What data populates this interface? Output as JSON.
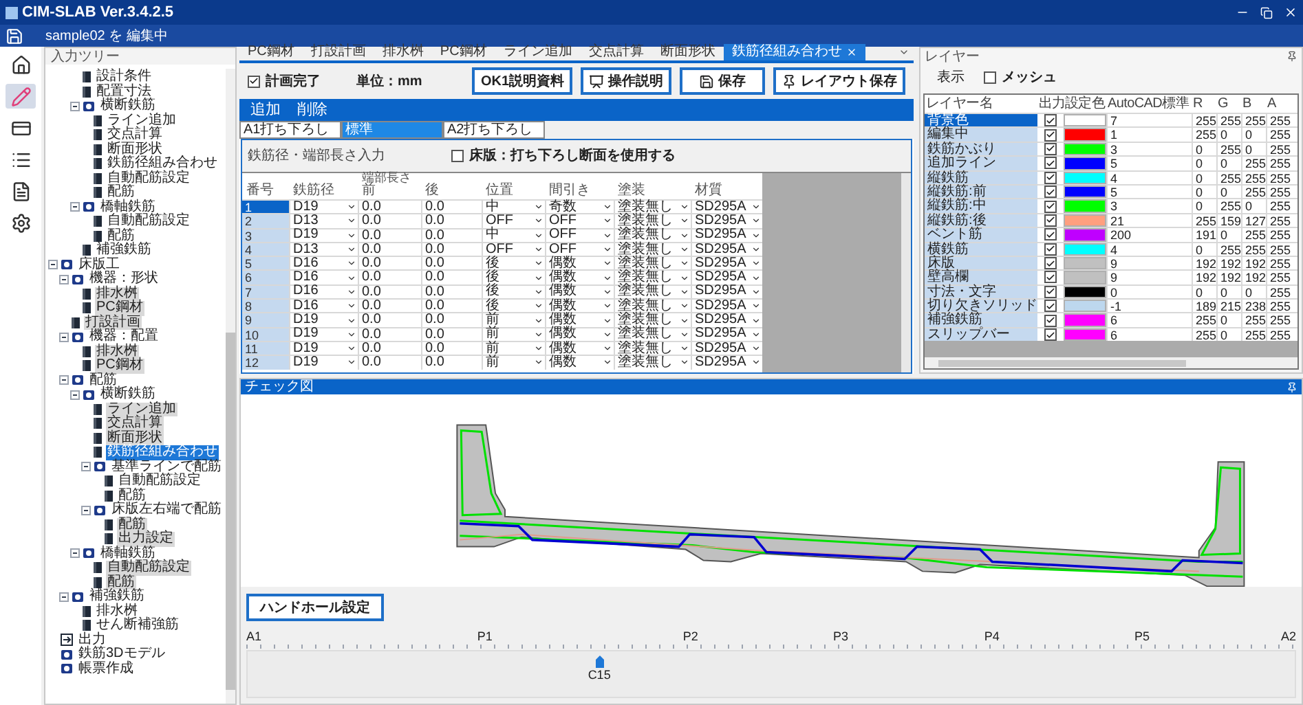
{
  "window": {
    "title": "CIM-SLAB Ver.3.4.2.5",
    "subtitle": "sample02 を 編集中"
  },
  "rail": [
    {
      "kind": "home",
      "selected": false
    },
    {
      "kind": "edit",
      "selected": true
    },
    {
      "kind": "card",
      "selected": false
    },
    {
      "kind": "list",
      "selected": false
    },
    {
      "kind": "document",
      "selected": false
    },
    {
      "kind": "settings",
      "selected": false
    }
  ],
  "tree": {
    "title": "入力ツリー",
    "items": [
      {
        "kind": "offscreen",
        "children": [
          {
            "kind": "offscreen",
            "children": [
              {
                "kind": "leaf",
                "label": "設計条件",
                "shaded": false,
                "selected": false
              },
              {
                "kind": "leaf",
                "label": "配置寸法",
                "shaded": false,
                "selected": false
              },
              {
                "kind": "folder",
                "label": "横断鉄筋",
                "shaded": false,
                "selected": false,
                "children": [
                  {
                    "kind": "leaf",
                    "label": "ライン追加",
                    "shaded": false,
                    "selected": false
                  },
                  {
                    "kind": "leaf",
                    "label": "交点計算",
                    "shaded": false,
                    "selected": false
                  },
                  {
                    "kind": "leaf",
                    "label": "断面形状",
                    "shaded": false,
                    "selected": false
                  },
                  {
                    "kind": "leaf",
                    "label": "鉄筋径組み合わせ",
                    "shaded": false,
                    "selected": false
                  },
                  {
                    "kind": "leaf",
                    "label": "自動配筋設定",
                    "shaded": false,
                    "selected": false
                  },
                  {
                    "kind": "leaf",
                    "label": "配筋",
                    "shaded": false,
                    "selected": false
                  }
                ]
              },
              {
                "kind": "folder",
                "label": "橋軸鉄筋",
                "shaded": false,
                "selected": false,
                "children": [
                  {
                    "kind": "leaf",
                    "label": "自動配筋設定",
                    "shaded": false,
                    "selected": false
                  },
                  {
                    "kind": "leaf",
                    "label": "配筋",
                    "shaded": false,
                    "selected": false
                  }
                ]
              },
              {
                "kind": "leaf",
                "label": "補強鉄筋",
                "shaded": false,
                "selected": false
              }
            ]
          }
        ]
      },
      {
        "kind": "folder",
        "label": "床版工",
        "shaded": false,
        "selected": false,
        "children": [
          {
            "kind": "folder",
            "label": "機器：形状",
            "shaded": false,
            "selected": false,
            "children": [
              {
                "kind": "leaf",
                "label": "排水桝",
                "shaded": true,
                "selected": false
              },
              {
                "kind": "leaf",
                "label": "PC鋼材",
                "shaded": true,
                "selected": false
              }
            ]
          },
          {
            "kind": "leaf",
            "label": "打設計画",
            "shaded": true,
            "selected": false
          },
          {
            "kind": "folder",
            "label": "機器：配置",
            "shaded": false,
            "selected": false,
            "children": [
              {
                "kind": "leaf",
                "label": "排水桝",
                "shaded": true,
                "selected": false
              },
              {
                "kind": "leaf",
                "label": "PC鋼材",
                "shaded": true,
                "selected": false
              }
            ]
          },
          {
            "kind": "folder",
            "label": "配筋",
            "shaded": false,
            "selected": false,
            "children": [
              {
                "kind": "folder",
                "label": "横断鉄筋",
                "shaded": false,
                "selected": false,
                "children": [
                  {
                    "kind": "leaf",
                    "label": "ライン追加",
                    "shaded": true,
                    "selected": false
                  },
                  {
                    "kind": "leaf",
                    "label": "交点計算",
                    "shaded": true,
                    "selected": false
                  },
                  {
                    "kind": "leaf",
                    "label": "断面形状",
                    "shaded": true,
                    "selected": false
                  },
                  {
                    "kind": "leaf",
                    "label": "鉄筋径組み合わせ",
                    "shaded": false,
                    "selected": true
                  },
                  {
                    "kind": "folder",
                    "label": "基準ラインで配筋",
                    "shaded": false,
                    "selected": false,
                    "children": [
                      {
                        "kind": "leaf",
                        "label": "自動配筋設定",
                        "shaded": false,
                        "selected": false
                      },
                      {
                        "kind": "leaf",
                        "label": "配筋",
                        "shaded": false,
                        "selected": false
                      }
                    ]
                  },
                  {
                    "kind": "folder",
                    "label": "床版左右端で配筋",
                    "shaded": false,
                    "selected": false,
                    "children": [
                      {
                        "kind": "leaf",
                        "label": "配筋",
                        "shaded": true,
                        "selected": false
                      },
                      {
                        "kind": "leaf",
                        "label": "出力設定",
                        "shaded": true,
                        "selected": false
                      }
                    ]
                  }
                ]
              },
              {
                "kind": "folder",
                "label": "橋軸鉄筋",
                "shaded": false,
                "selected": false,
                "children": [
                  {
                    "kind": "leaf",
                    "label": "自動配筋設定",
                    "shaded": true,
                    "selected": false
                  },
                  {
                    "kind": "leaf",
                    "label": "配筋",
                    "shaded": true,
                    "selected": false
                  }
                ]
              }
            ]
          },
          {
            "kind": "folder",
            "label": "補強鉄筋",
            "shaded": false,
            "selected": false,
            "children": [
              {
                "kind": "leaf",
                "label": "排水桝",
                "shaded": false,
                "selected": false
              },
              {
                "kind": "leaf",
                "label": "せん断補強筋",
                "shaded": false,
                "selected": false
              }
            ]
          }
        ]
      },
      {
        "kind": "output",
        "label": "出力",
        "shaded": false,
        "selected": false
      },
      {
        "kind": "folder",
        "label": "鉄筋3Dモデル",
        "shaded": false,
        "selected": false
      },
      {
        "kind": "folder",
        "label": "帳票作成",
        "shaded": false,
        "selected": false
      }
    ]
  },
  "tabs": [
    {
      "label": "PC鋼材",
      "selected": false
    },
    {
      "label": "打設計画",
      "selected": false
    },
    {
      "label": "排水桝",
      "selected": false
    },
    {
      "label": "PC鋼材",
      "selected": false
    },
    {
      "label": "ライン追加",
      "selected": false
    },
    {
      "label": "交点計算",
      "selected": false
    },
    {
      "label": "断面形状",
      "selected": false
    },
    {
      "label": "鉄筋径組み合わせ",
      "selected": true
    }
  ],
  "toolbar": {
    "plan_done": {
      "label": "計画完了",
      "checked": true
    },
    "unit": "単位：mm",
    "buttons": [
      {
        "label": "OK1説明資料",
        "kind": "plain"
      },
      {
        "label": "操作説明",
        "kind": "video"
      },
      {
        "label": "保存",
        "kind": "save"
      },
      {
        "label": "レイアウト保存",
        "kind": "pin"
      }
    ]
  },
  "action_bar": [
    "追加",
    "削除"
  ],
  "subtabs": [
    {
      "label": "A1打ち下ろし",
      "selected": false
    },
    {
      "label": "標準",
      "selected": true
    },
    {
      "label": "A2打ち下ろし",
      "selected": false
    }
  ],
  "section": {
    "title": "鉄筋径・端部長さ入力",
    "option": {
      "label": "床版：打ち下ろし断面を使用する",
      "checked": false
    }
  },
  "rebar_table": {
    "group_header": "端部長さ",
    "columns": [
      {
        "label": "番号",
        "kind": "number"
      },
      {
        "label": "鉄筋径",
        "kind": "dropdown"
      },
      {
        "label": "前",
        "kind": "text"
      },
      {
        "label": "後",
        "kind": "text"
      },
      {
        "label": "位置",
        "kind": "dropdown"
      },
      {
        "label": "間引き",
        "kind": "dropdown"
      },
      {
        "label": "塗装",
        "kind": "dropdown"
      },
      {
        "label": "材質",
        "kind": "dropdown"
      }
    ],
    "rows": [
      {
        "selected": true,
        "cells": [
          "1",
          "D19",
          "0.0",
          "0.0",
          "中",
          "奇数",
          "塗装無し",
          "SD295A"
        ]
      },
      {
        "selected": false,
        "cells": [
          "2",
          "D13",
          "0.0",
          "0.0",
          "OFF",
          "OFF",
          "塗装無し",
          "SD295A"
        ]
      },
      {
        "selected": false,
        "cells": [
          "3",
          "D19",
          "0.0",
          "0.0",
          "中",
          "OFF",
          "塗装無し",
          "SD295A"
        ]
      },
      {
        "selected": false,
        "cells": [
          "4",
          "D13",
          "0.0",
          "0.0",
          "OFF",
          "OFF",
          "塗装無し",
          "SD295A"
        ]
      },
      {
        "selected": false,
        "cells": [
          "5",
          "D16",
          "0.0",
          "0.0",
          "後",
          "偶数",
          "塗装無し",
          "SD295A"
        ]
      },
      {
        "selected": false,
        "cells": [
          "6",
          "D16",
          "0.0",
          "0.0",
          "後",
          "偶数",
          "塗装無し",
          "SD295A"
        ]
      },
      {
        "selected": false,
        "cells": [
          "7",
          "D16",
          "0.0",
          "0.0",
          "後",
          "偶数",
          "塗装無し",
          "SD295A"
        ]
      },
      {
        "selected": false,
        "cells": [
          "8",
          "D16",
          "0.0",
          "0.0",
          "後",
          "偶数",
          "塗装無し",
          "SD295A"
        ]
      },
      {
        "selected": false,
        "cells": [
          "9",
          "D19",
          "0.0",
          "0.0",
          "前",
          "偶数",
          "塗装無し",
          "SD295A"
        ]
      },
      {
        "selected": false,
        "cells": [
          "10",
          "D19",
          "0.0",
          "0.0",
          "前",
          "偶数",
          "塗装無し",
          "SD295A"
        ]
      },
      {
        "selected": false,
        "cells": [
          "11",
          "D19",
          "0.0",
          "0.0",
          "前",
          "偶数",
          "塗装無し",
          "SD295A"
        ]
      },
      {
        "selected": false,
        "cells": [
          "12",
          "D19",
          "0.0",
          "0.0",
          "前",
          "偶数",
          "塗装無し",
          "SD295A"
        ]
      }
    ]
  },
  "layers": {
    "title": "レイヤー",
    "display_label": "表示",
    "mesh": {
      "label": "メッシュ",
      "checked": false
    },
    "columns": [
      "レイヤー名",
      "出力",
      "設定色",
      "AutoCAD標準",
      "R",
      "G",
      "B",
      "A"
    ],
    "rows": [
      {
        "name": "背景色",
        "selected": true,
        "output": true,
        "color": "#ffffff",
        "aci": "7",
        "r": "255",
        "g": "255",
        "b": "255",
        "a": "255"
      },
      {
        "name": "編集中",
        "selected": false,
        "output": true,
        "color": "#ff0000",
        "aci": "1",
        "r": "255",
        "g": "0",
        "b": "0",
        "a": "255"
      },
      {
        "name": "鉄筋かぶり",
        "selected": false,
        "output": true,
        "color": "#00ff00",
        "aci": "3",
        "r": "0",
        "g": "255",
        "b": "0",
        "a": "255"
      },
      {
        "name": "追加ライン",
        "selected": false,
        "output": true,
        "color": "#0000ff",
        "aci": "5",
        "r": "0",
        "g": "0",
        "b": "255",
        "a": "255"
      },
      {
        "name": "縦鉄筋",
        "selected": false,
        "output": true,
        "color": "#00ffff",
        "aci": "4",
        "r": "0",
        "g": "255",
        "b": "255",
        "a": "255"
      },
      {
        "name": "縦鉄筋:前",
        "selected": false,
        "output": true,
        "color": "#0000ff",
        "aci": "5",
        "r": "0",
        "g": "0",
        "b": "255",
        "a": "255"
      },
      {
        "name": "縦鉄筋:中",
        "selected": false,
        "output": true,
        "color": "#00ff00",
        "aci": "3",
        "r": "0",
        "g": "255",
        "b": "0",
        "a": "255"
      },
      {
        "name": "縦鉄筋:後",
        "selected": false,
        "output": true,
        "color": "#ff9f7f",
        "aci": "21",
        "r": "255",
        "g": "159",
        "b": "127",
        "a": "255"
      },
      {
        "name": "ベント筋",
        "selected": false,
        "output": true,
        "color": "#bf00ff",
        "aci": "200",
        "r": "191",
        "g": "0",
        "b": "255",
        "a": "255"
      },
      {
        "name": "横鉄筋",
        "selected": false,
        "output": true,
        "color": "#00ffff",
        "aci": "4",
        "r": "0",
        "g": "255",
        "b": "255",
        "a": "255"
      },
      {
        "name": "床版",
        "selected": false,
        "output": true,
        "color": "#c0c0c0",
        "aci": "9",
        "r": "192",
        "g": "192",
        "b": "192",
        "a": "255"
      },
      {
        "name": "壁高欄",
        "selected": false,
        "output": true,
        "color": "#c0c0c0",
        "aci": "9",
        "r": "192",
        "g": "192",
        "b": "192",
        "a": "255"
      },
      {
        "name": "寸法・文字",
        "selected": false,
        "output": true,
        "color": "#000000",
        "aci": "0",
        "r": "0",
        "g": "0",
        "b": "0",
        "a": "255"
      },
      {
        "name": "切り欠きソリッド",
        "selected": false,
        "output": true,
        "color": "#bdd7ee",
        "aci": "-1",
        "r": "189",
        "g": "215",
        "b": "238",
        "a": "255"
      },
      {
        "name": "補強鉄筋",
        "selected": false,
        "output": true,
        "color": "#ff00ff",
        "aci": "6",
        "r": "255",
        "g": "0",
        "b": "255",
        "a": "255"
      },
      {
        "name": "スリップバー",
        "selected": false,
        "output": true,
        "color": "#ff00ff",
        "aci": "6",
        "r": "255",
        "g": "0",
        "b": "255",
        "a": "255"
      }
    ]
  },
  "check_view": {
    "title": "チェック図",
    "button": "ハンドホール設定",
    "stations": [
      "A1",
      "P1",
      "P2",
      "P3",
      "P4",
      "P5",
      "A2"
    ],
    "marker": "C15"
  }
}
